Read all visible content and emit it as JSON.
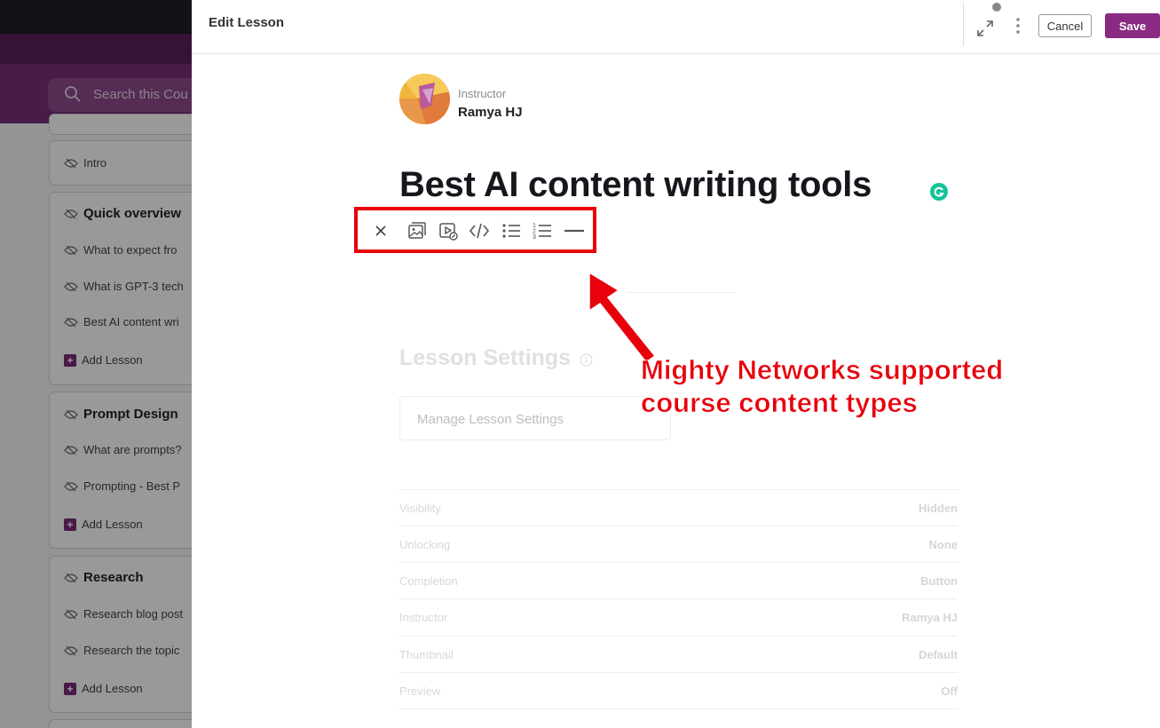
{
  "background": {
    "search_placeholder": "Search this Cou",
    "sections": [
      {
        "title": "",
        "items": [
          "Intro"
        ]
      },
      {
        "title": "Quick overview",
        "items": [
          "What to expect fro",
          "What is GPT-3 tech",
          "Best AI content wri"
        ],
        "add_label": "Add Lesson"
      },
      {
        "title": "Prompt Design",
        "items": [
          "What are prompts?",
          "Prompting - Best P"
        ],
        "add_label": "Add Lesson"
      },
      {
        "title": "Research",
        "items": [
          "Research blog post",
          "Research the topic"
        ],
        "add_label": "Add Lesson"
      }
    ]
  },
  "modal": {
    "title": "Edit Lesson",
    "cancel_label": "Cancel",
    "save_label": "Save",
    "instructor": {
      "role": "Instructor",
      "name": "Ramya HJ"
    },
    "lesson_title": "Best AI content writing tools",
    "toolbar": {
      "items": [
        "close-icon",
        "image-gallery-icon",
        "video-link-icon",
        "embed-code-icon",
        "bullet-list-icon",
        "numbered-list-icon",
        "divider-icon"
      ]
    },
    "settings": {
      "title": "Lesson Settings",
      "manage_label": "Manage Lesson Settings",
      "rows": [
        {
          "label": "Visibility",
          "value": "Hidden"
        },
        {
          "label": "Unlocking",
          "value": "None"
        },
        {
          "label": "Completion",
          "value": "Button"
        },
        {
          "label": "Instructor",
          "value": "Ramya HJ"
        },
        {
          "label": "Thumbnail",
          "value": "Default"
        },
        {
          "label": "Preview",
          "value": "Off"
        }
      ]
    }
  },
  "annotation": {
    "line1": "Mighty Networks supported",
    "line2": "course content types",
    "color": "#e8000b"
  },
  "colors": {
    "brand": "#8a2a82",
    "highlight": "#e8000b"
  }
}
